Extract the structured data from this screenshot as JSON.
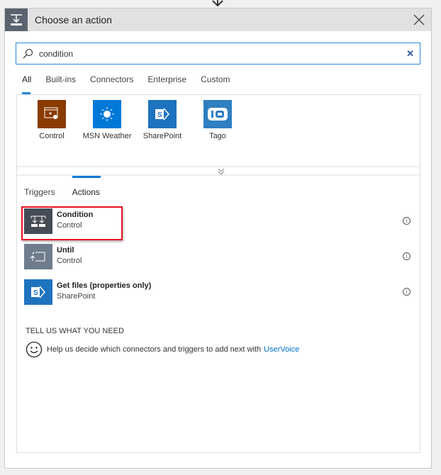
{
  "header": {
    "title": "Choose an action",
    "icon": "condition-icon",
    "close_icon": "close-icon"
  },
  "search": {
    "value": "condition",
    "icon": "search-icon",
    "clear_icon": "clear-icon"
  },
  "tabs": [
    {
      "label": "All",
      "active": true
    },
    {
      "label": "Built-ins"
    },
    {
      "label": "Connectors"
    },
    {
      "label": "Enterprise"
    },
    {
      "label": "Custom"
    }
  ],
  "connectors": [
    {
      "label": "Control",
      "color": "#8a3b00",
      "icon": "control-icon"
    },
    {
      "label": "MSN Weather",
      "color": "#0078d7",
      "icon": "sun-icon"
    },
    {
      "label": "SharePoint",
      "color": "#1e73be",
      "icon": "sharepoint-icon"
    },
    {
      "label": "Tago",
      "color": "#2f7fc1",
      "icon": "tago-icon"
    }
  ],
  "expand_icon": "chevron-double-down-icon",
  "subtabs": [
    {
      "label": "Triggers"
    },
    {
      "label": "Actions",
      "active": true
    }
  ],
  "actions": [
    {
      "title": "Condition",
      "subtitle": "Control",
      "color": "#464c56",
      "icon": "condition-icon",
      "highlighted": true
    },
    {
      "title": "Until",
      "subtitle": "Control",
      "color": "#6e7c8c",
      "icon": "until-icon"
    },
    {
      "title": "Get files (properties only)",
      "subtitle": "SharePoint",
      "color": "#1e73be",
      "icon": "sharepoint-icon"
    }
  ],
  "feedback": {
    "heading": "TELL US WHAT YOU NEED",
    "text": "Help us decide which connectors and triggers to add next with",
    "link": "UserVoice",
    "icon": "smiley-icon"
  },
  "colors": {
    "accent": "#2b88d8",
    "highlight": "#e81123",
    "link": "#0072c6"
  }
}
